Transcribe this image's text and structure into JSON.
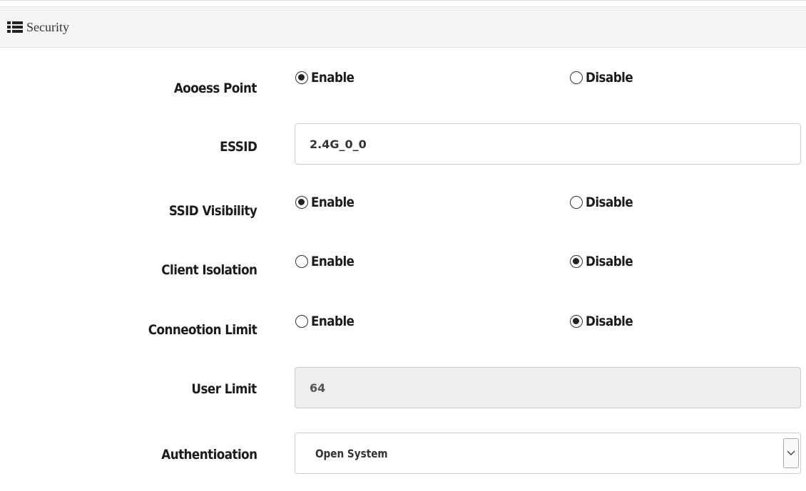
{
  "panel": {
    "title": "Security"
  },
  "rows": {
    "access_point": {
      "label": "Aooess Point",
      "options": [
        "Enable",
        "Disable"
      ],
      "selected": "Enable"
    },
    "essid": {
      "label": "ESSID",
      "value": "2.4G_0_0"
    },
    "ssid_visibility": {
      "label": "SSID Visibility",
      "options": [
        "Enable",
        "Disable"
      ],
      "selected": "Enable"
    },
    "client_isolation": {
      "label": "Client Isolation",
      "options": [
        "Enable",
        "Disable"
      ],
      "selected": "Disable"
    },
    "connection_limit": {
      "label": "Conneotion Limit",
      "options": [
        "Enable",
        "Disable"
      ],
      "selected": "Disable"
    },
    "user_limit": {
      "label": "User Limit",
      "value": "64"
    },
    "authentication": {
      "label": "Authentioation",
      "selected": "Open System"
    }
  },
  "icons": {
    "header": "list-icon",
    "select": "chevron-down-icon"
  }
}
